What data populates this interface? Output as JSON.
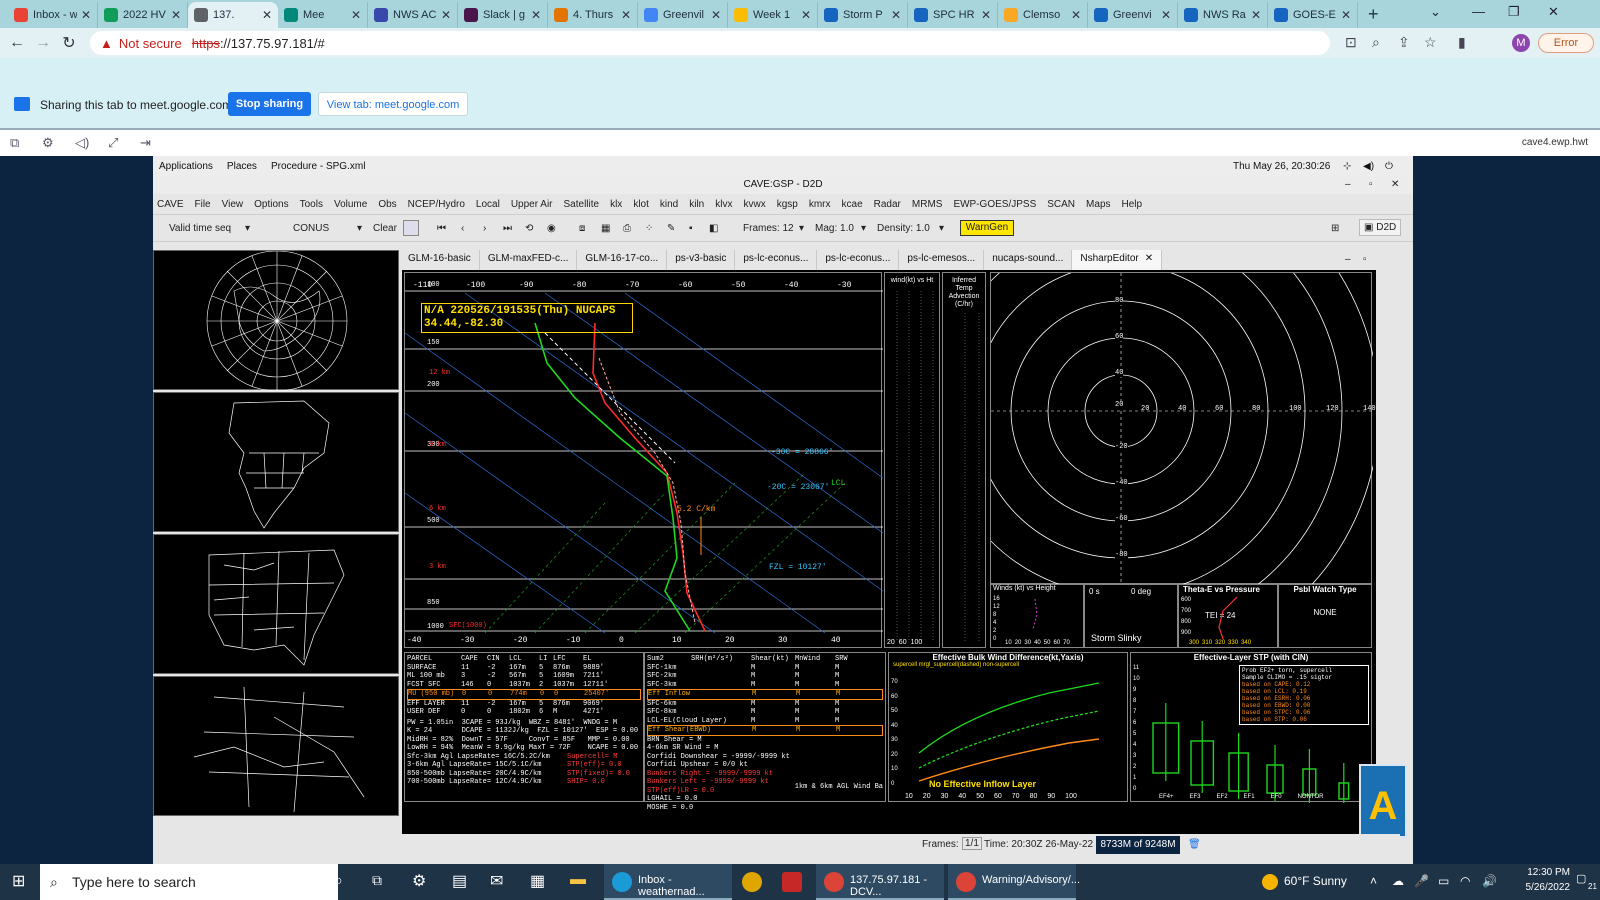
{
  "browser": {
    "tabs": [
      {
        "label": "Inbox - w",
        "color": "#ea4335"
      },
      {
        "label": "2022 HV",
        "color": "#0f9d58"
      },
      {
        "label": "137.",
        "color": "#5f6368"
      },
      {
        "label": "Mee",
        "color": "#00897b"
      },
      {
        "label": "NWS AC",
        "color": "#3949ab"
      },
      {
        "label": "Slack | g",
        "color": "#4a154b"
      },
      {
        "label": "4. Thurs",
        "color": "#e37400"
      },
      {
        "label": "Greenvil",
        "color": "#4285f4"
      },
      {
        "label": "Week 1",
        "color": "#fbbc04"
      },
      {
        "label": "Storm P",
        "color": "#1565c0"
      },
      {
        "label": "SPC HR",
        "color": "#1565c0"
      },
      {
        "label": "Clemso",
        "color": "#f9a825"
      },
      {
        "label": "Greenvi",
        "color": "#1565c0"
      },
      {
        "label": "NWS Ra",
        "color": "#1565c0"
      },
      {
        "label": "GOES-E",
        "color": "#1565c0"
      }
    ],
    "new_tab": "+",
    "address": {
      "warning": "Not secure",
      "scheme": "https",
      "rest": "://137.75.97.181/#"
    },
    "profile_initial": "M",
    "error_label": "Error"
  },
  "sharing": {
    "message": "Sharing this tab to meet.google.com",
    "stop_label": "Stop sharing",
    "view_label": "View tab: meet.google.com"
  },
  "remote": {
    "host": "cave4.ewp.hwt",
    "gnome": {
      "applications": "Applications",
      "places": "Places",
      "procedure": "Procedure - SPG.xml",
      "clock": "Thu May 26, 20:30:26"
    },
    "title": "CAVE:GSP - D2D",
    "menu": [
      "CAVE",
      "File",
      "View",
      "Options",
      "Tools",
      "Volume",
      "Obs",
      "NCEP/Hydro",
      "Local",
      "Upper Air",
      "Satellite",
      "klx",
      "klot",
      "kind",
      "kiln",
      "klvx",
      "kvwx",
      "kgsp",
      "kmrx",
      "kcae",
      "Radar",
      "MRMS",
      "EWP-GOES/JPSS",
      "SCAN",
      "Maps",
      "Help"
    ],
    "toolbar": {
      "time_mode": "Valid time seq",
      "scale": "CONUS",
      "clear": "Clear",
      "frames": "Frames: 12",
      "mag": "Mag: 1.0",
      "density": "Density: 1.0",
      "warngen": "WarnGen",
      "d2d": "D2D"
    },
    "editor_tabs": [
      "GLM-16-basic",
      "GLM-maxFED-c...",
      "GLM-16-17-co...",
      "ps-v3-basic",
      "ps-lc-econus...",
      "ps-lc-econus...",
      "ps-lc-emesos...",
      "nucaps-sound...",
      "NsharpEditor"
    ],
    "status": {
      "frames_label": "Frames:",
      "frames_value": "1/1",
      "time": "Time: 20:30Z 26-May-22",
      "memory": "8733M of 9248M"
    }
  },
  "nsharp": {
    "skewt_header": "N/A 220526/191535(Thu) NUCAPS",
    "skewt_loc": "34.44,-82.30",
    "temp_ticks": [
      "-110",
      "-100",
      "-90",
      "-80",
      "-70",
      "-60",
      "-50",
      "-40",
      "-30"
    ],
    "pressure_ticks": [
      "100",
      "150",
      "200",
      "300",
      "500",
      "850",
      "1000"
    ],
    "height_marks": [
      "12 km",
      "9 km",
      "6 km",
      "3 km"
    ],
    "bottom_temps": [
      "-40",
      "-30",
      "-20",
      "-10",
      "0",
      "10",
      "20",
      "30",
      "40"
    ],
    "annotations": {
      "h30c": "-30C = 28866'",
      "h20c": "-20C = 23067'",
      "fzl": "FZL = 10127'",
      "lcl": "LCL",
      "lapse": "5.2 C/km",
      "sfc": "SFC(1000)"
    },
    "wind_hdr": "wind(kt) vs Ht",
    "temp_adv_hdr": "Inferred Temp Advection (C/hr)",
    "adv_axis": [
      "20",
      "60",
      "100"
    ],
    "hodo_rings": [
      "20",
      "40",
      "60",
      "80",
      "100",
      "120",
      "140"
    ],
    "hodo_axis_labels": [
      "80",
      "60",
      "40",
      "20",
      "-20",
      "-40",
      "-60",
      "-80"
    ],
    "inset": {
      "winds_title": "Winds (kt) vs Height",
      "winds_axis": [
        "10",
        "20",
        "30",
        "40",
        "50",
        "60",
        "70"
      ],
      "winds_levels": [
        "16",
        "12",
        "8",
        "4",
        "2",
        "0"
      ],
      "storm_slinky": "Storm Slinky",
      "zero_s": "0 s",
      "zero_deg": "0 deg",
      "theta_title": "Theta-E vs Pressure",
      "tei": "TEI = 24",
      "theta_axis": [
        "300",
        "310",
        "320",
        "330",
        "340"
      ],
      "theta_press": [
        "600",
        "700",
        "800",
        "900"
      ],
      "watch_title": "Psbl Watch Type",
      "watch_value": "NONE"
    },
    "parcel_table": {
      "headers": [
        "PARCEL",
        "CAPE",
        "CIN",
        "LCL",
        "LI",
        "LFC",
        "EL"
      ],
      "rows": [
        [
          "SURFACE",
          "11",
          "-2",
          "167m",
          "5",
          "876m",
          "9889'"
        ],
        [
          "ML 100 mb",
          "3",
          "-2",
          "567m",
          "5",
          "1609m",
          "7211'"
        ],
        [
          "FCST SFC",
          "146",
          "0",
          "1037m",
          "2",
          "1037m",
          "12711'"
        ],
        [
          "MU (950 mb)",
          "0",
          "0",
          "774m",
          "0",
          "0",
          "25407'"
        ],
        [
          "EFF LAYER",
          "11",
          "-2",
          "167m",
          "5",
          "876m",
          "9069'"
        ],
        [
          "USER DEF",
          "0",
          "0",
          "1802m",
          "6",
          "M",
          "4271'"
        ]
      ],
      "indices": [
        "PW = 1.05in  3CAPE = 93J/kg  WBZ = 8481'  WNDG = M",
        "K = 24       DCAPE = 1132J/kg  FZL = 10127'  ESP = 0.00",
        "MidRH = 82%  DownT = 57F     ConvT = 85F   MMP = 0.00",
        "LowRH = 94%  MeanW = 9.9g/kg MaxT = 72F    NCAPE = 0.00"
      ],
      "lapse": [
        "Sfc-3km Agl LapseRate= 16C/5.2C/km",
        "3-6km Agl LapseRate= 15C/5.1C/km",
        "850-500mb LapseRate= 20C/4.9C/km",
        "700-500mb LapseRate= 12C/4.9C/km"
      ],
      "supercell": [
        "Supercell= M",
        "STP(eff)= 0.0",
        "STP(fixed)= 0.0",
        "SHIP= 0.0"
      ]
    },
    "kin_table": {
      "headers": [
        "Sum2",
        "SRH(m²/s²)",
        "Shear(kt)",
        "MnWind",
        "SRW"
      ],
      "rows": [
        "SFC-1km",
        "SFC-2km",
        "SFC-3km",
        "Eff Inflow",
        "SFC-6km",
        "SFC-8km",
        "LCL-EL(Cloud Layer)",
        "Eff Shear(EBWD)"
      ],
      "misc": [
        "BRN Shear = M",
        "4-6km SR Wind = M",
        "Corfidi Downshear = -9999/-9999 kt",
        "Corfidi Upshear = 0/0 kt",
        "Bunkers Right = -9999/-9999 kt",
        "Bunkers Left = -9999/-9999 kt",
        "STP(eff)LR = 0.0",
        "LGHAIL = 0.0",
        "MOSHE = 0.0"
      ],
      "agl": "1km & 6km AGL Wind Ba"
    },
    "ebwd": {
      "title": "Effective Bulk Wind Difference(kt,Yaxis)",
      "legend": "supercell mrgl_supercell(dashed) non-supercell",
      "no_inflow": "No Effective Inflow Layer",
      "x_ticks": [
        "10",
        "20",
        "30",
        "40",
        "50",
        "60",
        "70",
        "80",
        "90",
        "100"
      ],
      "y_ticks": [
        "70",
        "60",
        "50",
        "40",
        "30",
        "20",
        "10",
        "0"
      ]
    },
    "stp": {
      "title": "Effective-Layer STP (with CIN)",
      "y_ticks": [
        "11",
        "10",
        "9",
        "8",
        "7",
        "6",
        "5",
        "4",
        "3",
        "2",
        "1",
        "0"
      ],
      "categories": [
        "EF4+",
        "EF3",
        "EF2",
        "EF1",
        "EF0",
        "NONTOR"
      ],
      "prob_text": [
        "Prob EF2+ torn, supercell",
        "Sample CLIMO = .15 sigtor",
        "based on CAPE:   0.12",
        "based on LCL:    0.19",
        "based on ESRH:   0.06",
        "based on EBWD:   0.00",
        "based on STPC:   0.06",
        "based on STP:    0.06"
      ]
    }
  },
  "taskbar": {
    "search_placeholder": "Type here to search",
    "apps": [
      {
        "label": "Inbox - weathernad..."
      },
      {
        "label": "137.75.97.181 - DCV..."
      },
      {
        "label": "Warning/Advisory/..."
      }
    ],
    "weather": "60°F  Sunny",
    "time": "12:30 PM",
    "date": "5/26/2022",
    "notif": "21"
  }
}
